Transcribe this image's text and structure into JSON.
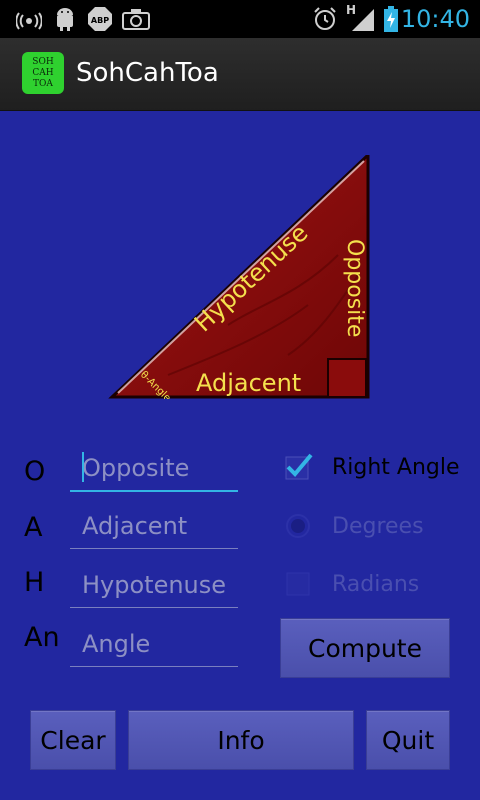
{
  "status_bar": {
    "time": "10:40",
    "network_label": "H",
    "icons": [
      "wifi-icon",
      "android-debug-icon",
      "adblock-icon",
      "camera-icon",
      "alarm-icon",
      "signal-icon",
      "battery-icon"
    ]
  },
  "action_bar": {
    "app_icon_text": [
      "SOH",
      "CAH",
      "TOA"
    ],
    "title": "SohCahToa"
  },
  "diagram": {
    "hypotenuse_label": "Hypotenuse",
    "opposite_label": "Opposite",
    "adjacent_label": "Adjacent",
    "angle_label": "θ-Angle"
  },
  "form": {
    "rows": [
      {
        "short": "O",
        "placeholder": "Opposite",
        "value": ""
      },
      {
        "short": "A",
        "placeholder": "Adjacent",
        "value": ""
      },
      {
        "short": "H",
        "placeholder": "Hypotenuse",
        "value": ""
      },
      {
        "short": "An",
        "placeholder": "Angle",
        "value": ""
      }
    ],
    "right_angle": {
      "label": "Right Angle",
      "checked": true
    },
    "degrees": {
      "label": "Degrees",
      "selected": true,
      "enabled": false
    },
    "radians": {
      "label": "Radians",
      "selected": false,
      "enabled": false
    },
    "compute_label": "Compute"
  },
  "bottom_buttons": {
    "clear_label": "Clear",
    "info_label": "Info",
    "quit_label": "Quit"
  },
  "colors": {
    "background": "#2227a0",
    "accent": "#33b5e5",
    "triangle_fill": "#8a0c0c",
    "triangle_text": "#f4e04d"
  }
}
